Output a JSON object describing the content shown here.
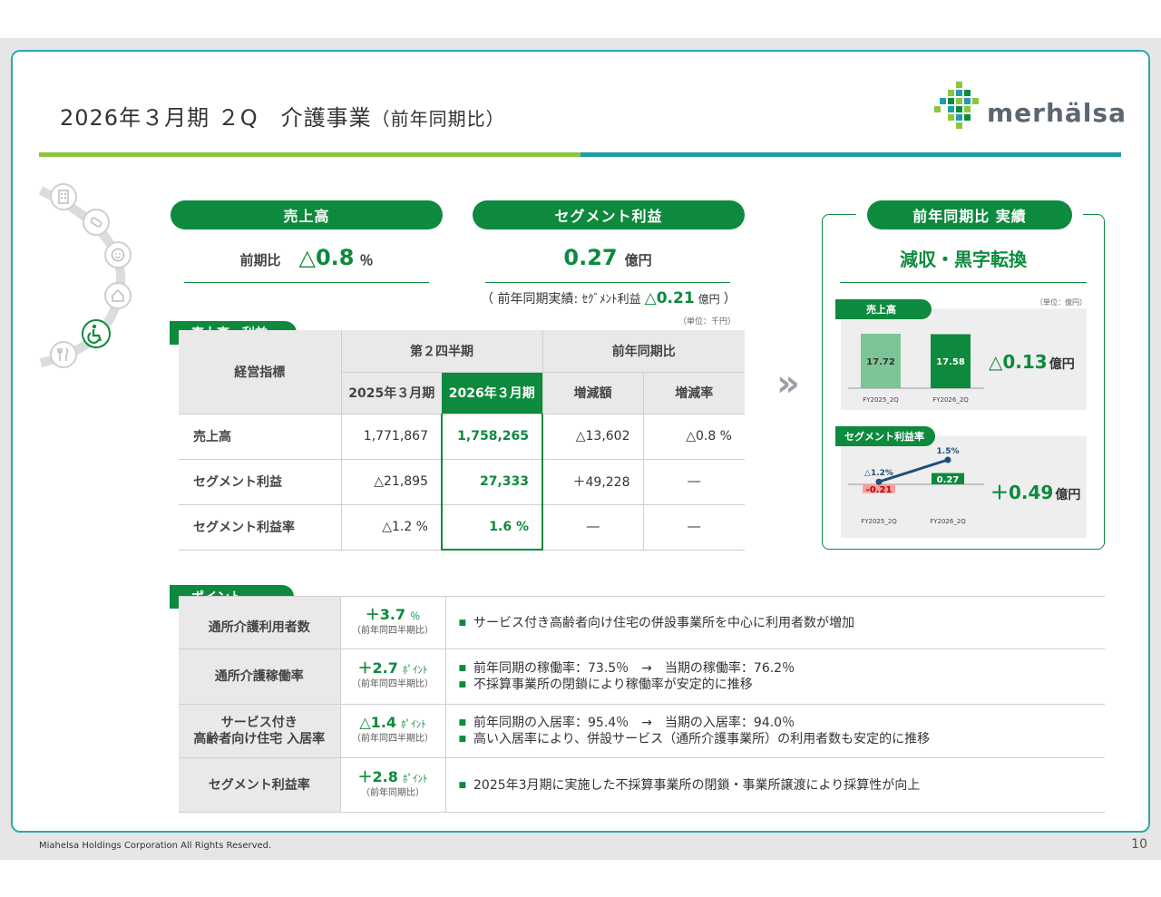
{
  "header": {
    "title": "2026年３月期 ２Q　介護事業",
    "title_paren": "（前年同期比）",
    "logo_text": "merhälsa"
  },
  "kpi": {
    "sales_pill": "売上高",
    "sales_label": "前期比",
    "sales_value": "△0.8",
    "sales_unit": "％",
    "segment_pill": "セグメント利益",
    "segment_value": "0.27",
    "segment_unit": "億円",
    "prior_note_open": "（ 前年同期実績: ",
    "prior_note_label": "ｾｸﾞﾒﾝﾄ利益",
    "prior_note_value": "△0.21",
    "prior_note_unit": "億円",
    "prior_note_close": "）"
  },
  "table": {
    "tag": "売上高・利益",
    "unit_note": "（単位：千円）",
    "col_indicator": "経営指標",
    "col_q2": "第２四半期",
    "col_yoy": "前年同期比",
    "col_2025": "2025年３月期",
    "col_2026": "2026年３月期",
    "col_diff": "増減額",
    "col_rate": "増減率",
    "rows": [
      {
        "label": "売上高",
        "v2025": "1,771,867",
        "v2026": "1,758,265",
        "diff": "△13,602",
        "rate": "△0.8 %"
      },
      {
        "label": "セグメント利益",
        "v2025": "△21,895",
        "v2026": "27,333",
        "diff": "＋49,228",
        "rate": "―"
      },
      {
        "label": "セグメント利益率",
        "v2025": "△1.2 %",
        "v2026": "1.6 %",
        "diff": "―",
        "rate": "―"
      }
    ]
  },
  "points": {
    "tag": "ポイント",
    "rows": [
      {
        "label1": "通所介護利用者数",
        "label2": "",
        "value": "＋3.7",
        "unit": "％",
        "sub": "（前年同四半期比）",
        "lines": [
          "サービス付き高齢者向け住宅の併設事業所を中心に利用者数が増加"
        ]
      },
      {
        "label1": "通所介護稼働率",
        "label2": "",
        "value": "＋2.7",
        "unit": "ﾎﾟｲﾝﾄ",
        "sub": "（前年同四半期比）",
        "lines": [
          "前年同期の稼働率：73.5％　→　当期の稼働率：76.2％",
          "不採算事業所の閉鎖により稼働率が安定的に推移"
        ]
      },
      {
        "label1": "サービス付き",
        "label2": "高齢者向け住宅 入居率",
        "value": "△1.4",
        "unit": "ﾎﾟｲﾝﾄ",
        "sub": "（前年同四半期比）",
        "lines": [
          "前年同期の入居率：95.4％　→　当期の入居率：94.0％",
          "高い入居率により、併設サービス（通所介護事業所）の利用者数も安定的に推移"
        ]
      },
      {
        "label1": "セグメント利益率",
        "label2": "",
        "value": "＋2.8",
        "unit": "ﾎﾟｲﾝﾄ",
        "sub": "（前年同期比）",
        "lines": [
          "2025年3月期に実施した不採算事業所の閉鎖・事業所譲渡により採算性が向上"
        ]
      }
    ]
  },
  "summary": {
    "pill": "前年同期比 実績",
    "headline": "減収・黒字転換",
    "unit_note": "（単位：億円）",
    "sales_tag": "売上高",
    "sales_delta": "△0.13",
    "sales_delta_unit": "億円",
    "margin_tag": "セグメント利益率",
    "margin_delta": "＋0.49",
    "margin_delta_unit": "億円"
  },
  "chart_data": [
    {
      "type": "bar",
      "title": "売上高",
      "categories": [
        "FY2025_2Q",
        "FY2026_2Q"
      ],
      "values": [
        17.72,
        17.58
      ],
      "value_labels": [
        "17.72",
        "17.58"
      ],
      "colors": [
        "#7dc596",
        "#0d8a3d"
      ]
    },
    {
      "type": "bar",
      "title": "セグメント利益率",
      "categories": [
        "FY2025_2Q",
        "FY2026_2Q"
      ],
      "values": [
        -0.21,
        0.27
      ],
      "value_labels": [
        "-0.21",
        "0.27"
      ],
      "colors": [
        "#f4a0a0",
        "#0d8a3d"
      ],
      "line_series": {
        "values": [
          -1.2,
          1.5
        ],
        "labels": [
          "△1.2%",
          "1.5%"
        ],
        "color": "#1f4e79"
      }
    }
  ],
  "footer": {
    "copyright": "Miahelsa Holdings Corporation All Rights Reserved.",
    "page": "10"
  },
  "colors": {
    "brand_green": "#0d8a3d",
    "teal": "#1f9ea3",
    "lime": "#8cc63f"
  }
}
